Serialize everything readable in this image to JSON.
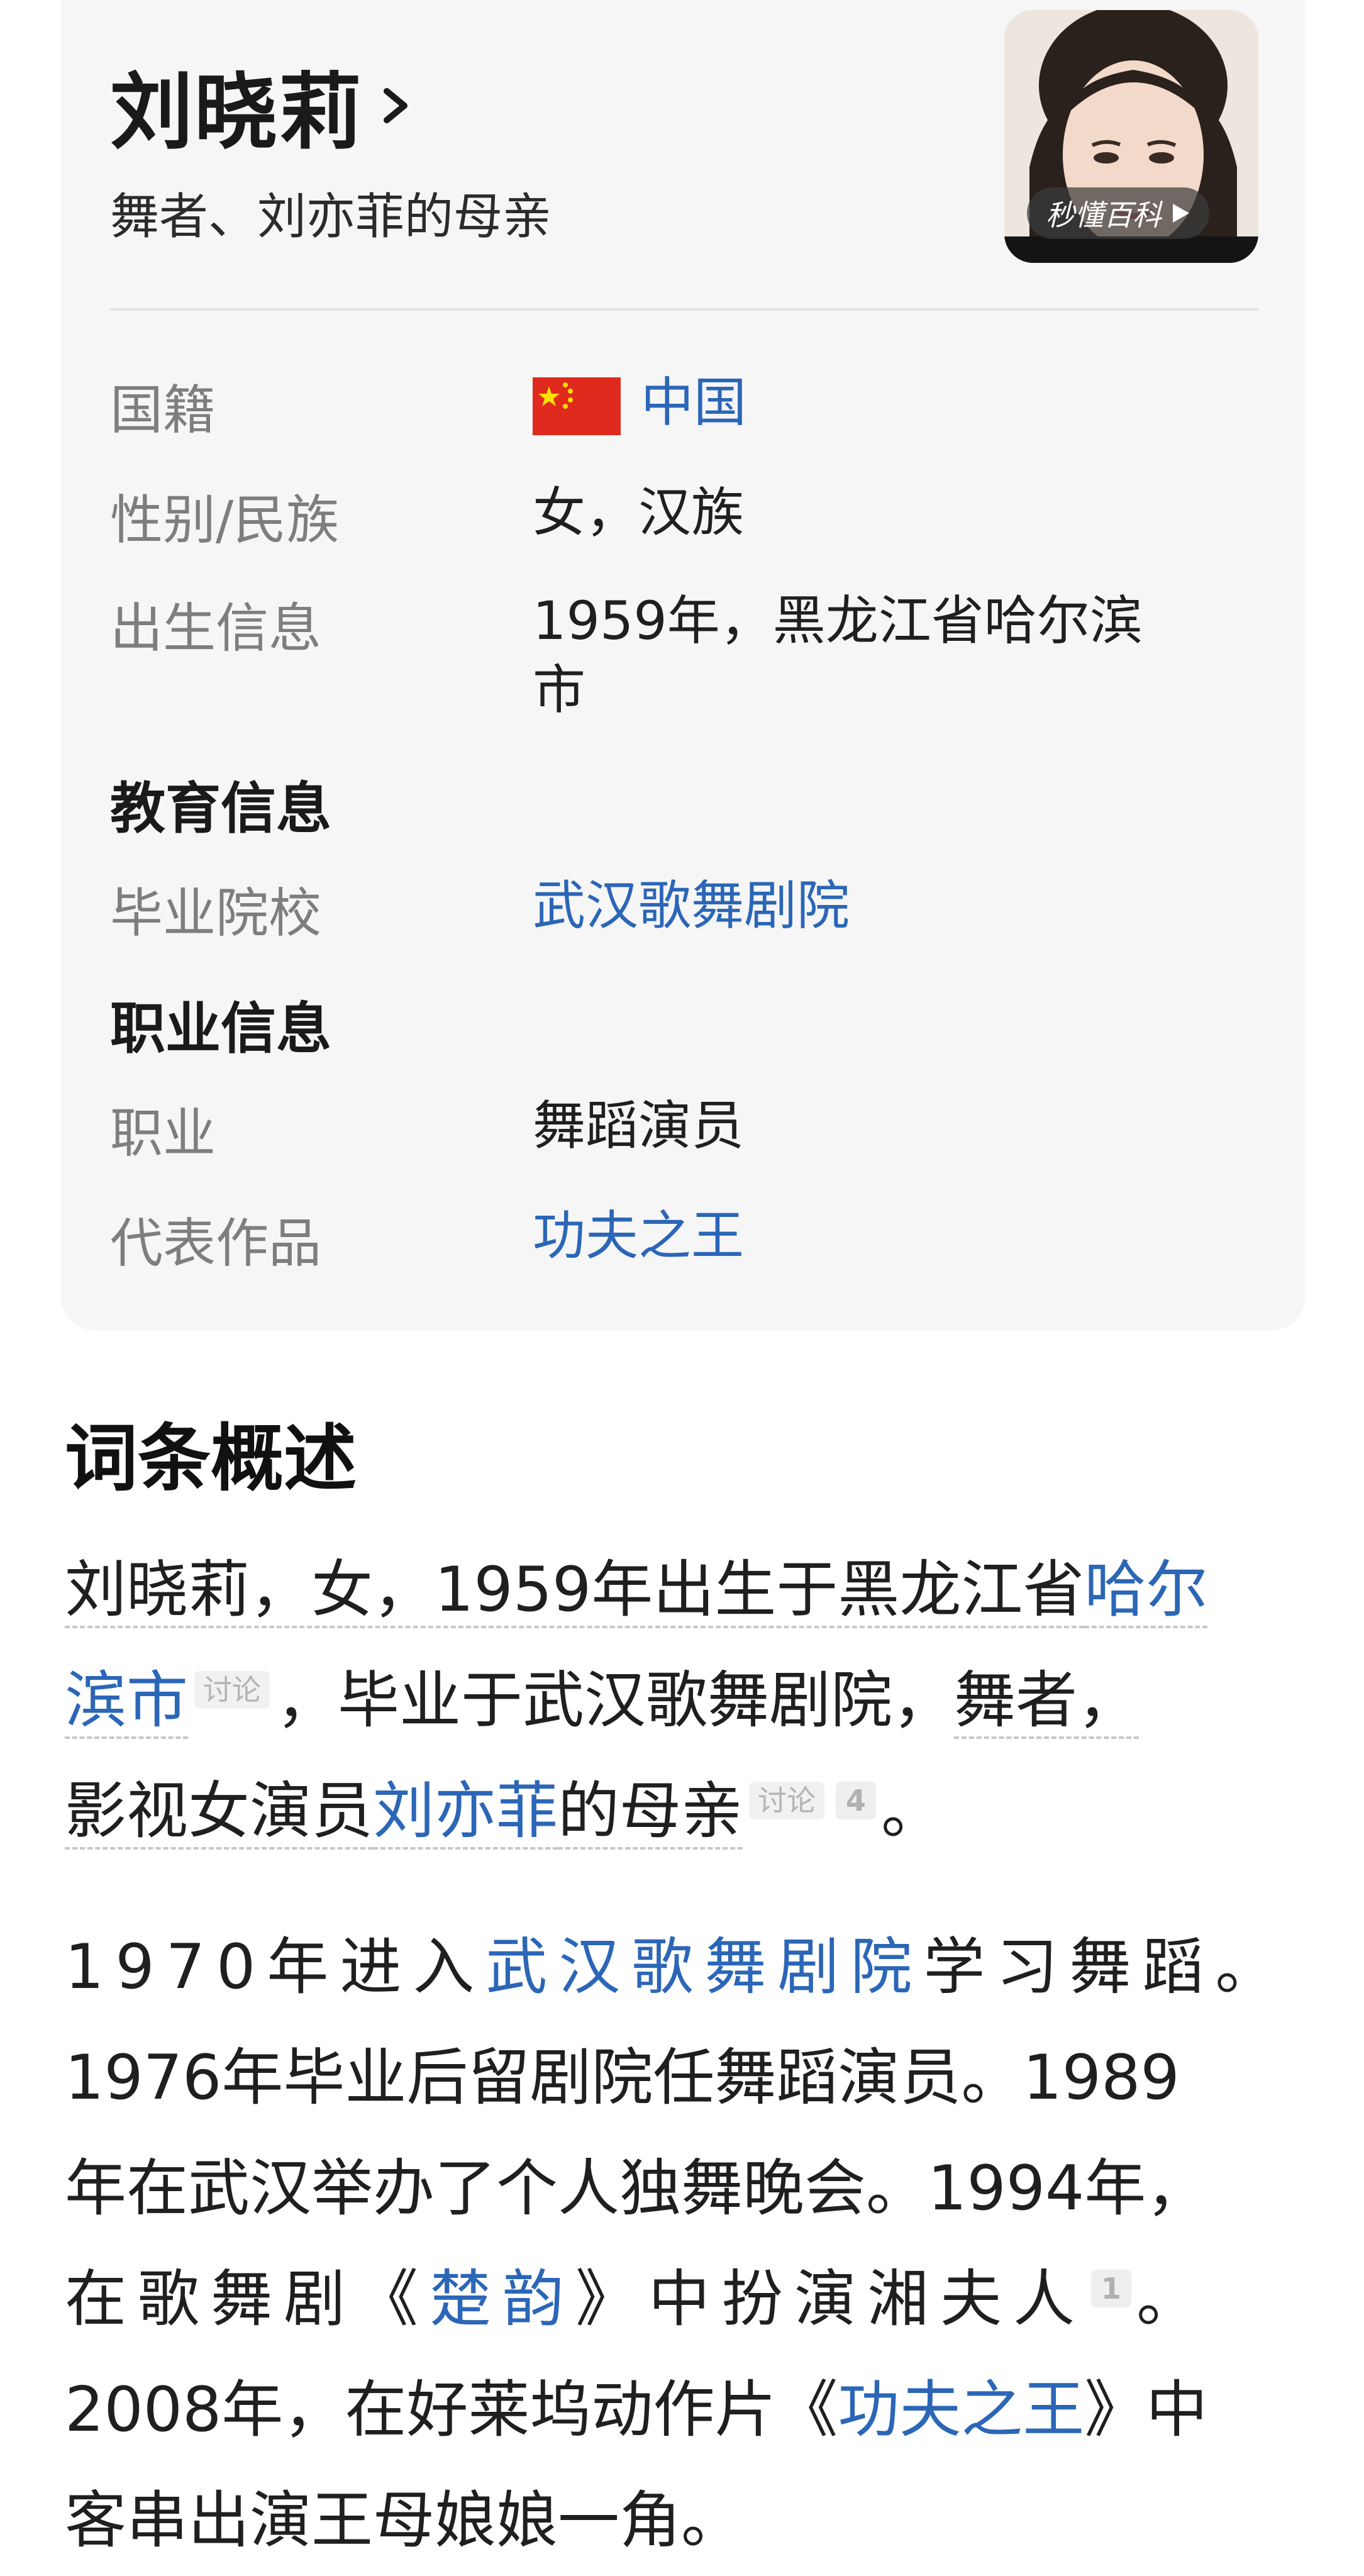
{
  "card": {
    "name": "刘晓莉",
    "subtitle": "舞者、刘亦菲的母亲",
    "photo_badge": "秒懂百科",
    "nationality": {
      "label": "国籍",
      "value": "中国",
      "flag": "china-flag-icon"
    },
    "gender": {
      "label": "性别/民族",
      "value": "女，汉族"
    },
    "birth": {
      "label": "出生信息",
      "value_line1": "1959年，黑龙江省哈尔滨",
      "value_line2": "市"
    },
    "education_heading": "教育信息",
    "school": {
      "label": "毕业院校",
      "value": "武汉歌舞剧院"
    },
    "career_heading": "职业信息",
    "occupation": {
      "label": "职业",
      "value": "舞蹈演员"
    },
    "works": {
      "label": "代表作品",
      "value": "功夫之王"
    }
  },
  "overview": {
    "title": "词条概述",
    "p1": {
      "l1a": "刘晓莉，女，1959年出生于黑龙江省",
      "l1b": "哈尔",
      "l2a": "滨市",
      "l2tag": "讨论",
      "l2b": "，毕业于武汉歌舞剧院，",
      "l2c": "舞者，",
      "l3a": "影视女演员",
      "l3b": "刘亦菲",
      "l3c": "的母亲",
      "l3tag": "讨论",
      "l3ref": "4",
      "l3end": "。"
    },
    "p2": {
      "l1a": "1970年进入",
      "l1b": "武汉歌舞剧院",
      "l1c": "学习舞蹈。",
      "l2": "1976年毕业后留剧院任舞蹈演员。1989",
      "l3": "年在武汉举办了个人独舞晚会。1994年，",
      "l4a": "在歌舞剧《",
      "l4b": "楚韵",
      "l4c": "》中扮演湘夫人",
      "l4ref": "1",
      "l4end": "。",
      "l5a": "2008年，在好莱坞动作片《",
      "l5b": "功夫之王",
      "l5c": "》中",
      "l6": "客串出演王母娘娘一角。"
    }
  },
  "colors": {
    "link": "#2b66b7",
    "card_bg": "#f6f6f6",
    "label": "#7e7e7e"
  }
}
